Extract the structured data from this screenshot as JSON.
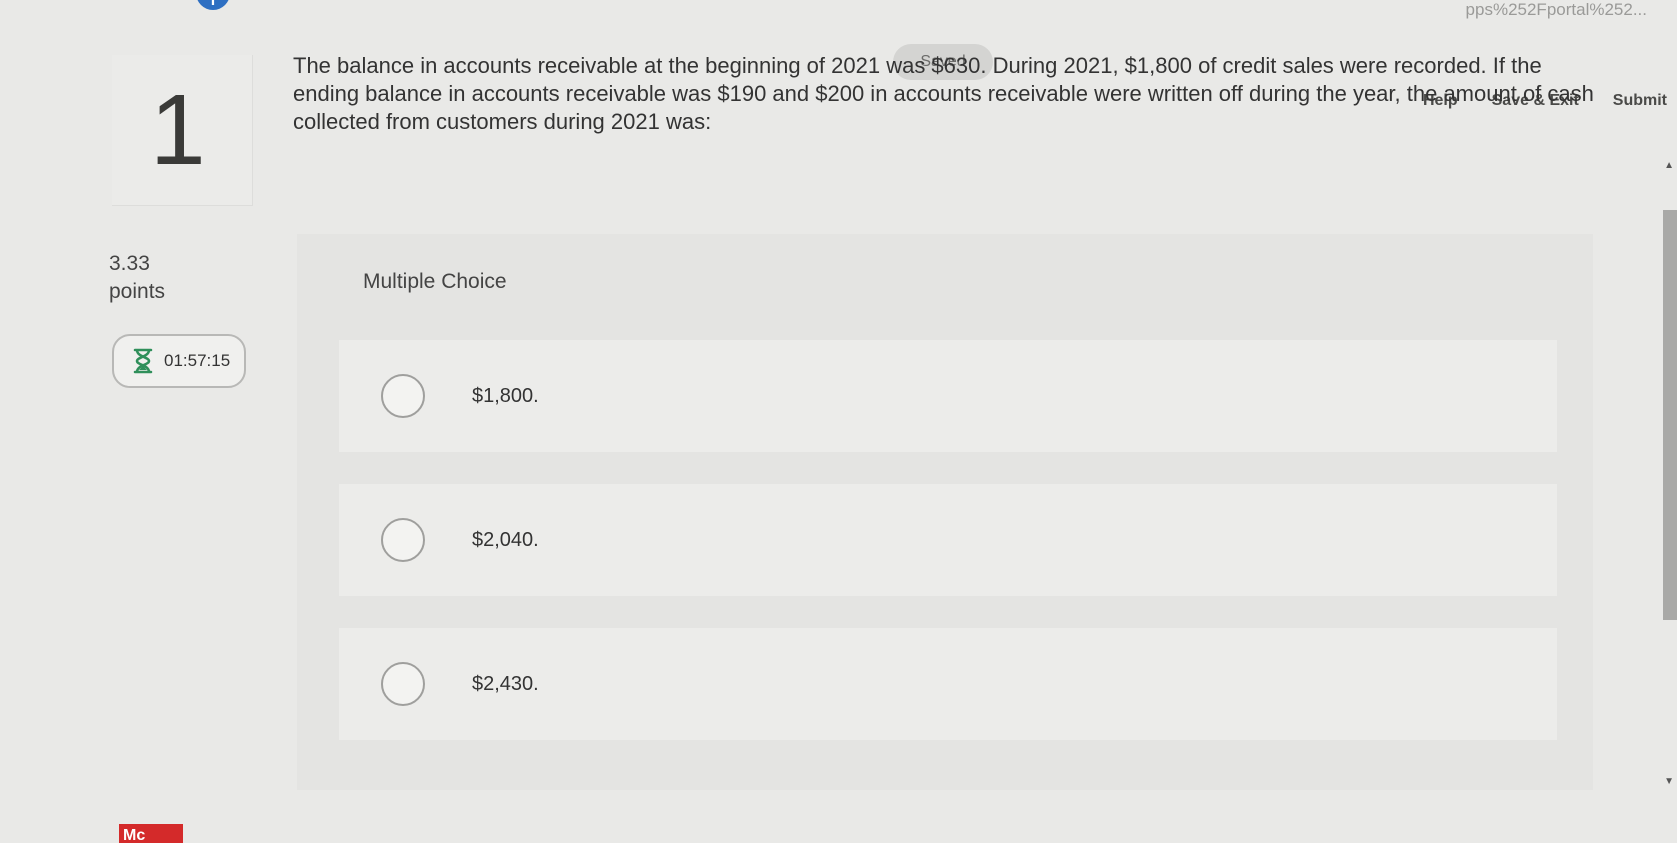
{
  "browser": {
    "url_fragment": "pps%252Fportal%252..."
  },
  "header": {
    "saved_status": "Saved",
    "links": {
      "help": "Help",
      "save_exit": "Save & Exit",
      "submit": "Submit"
    }
  },
  "question": {
    "number": "1",
    "text": "The balance in accounts receivable at the beginning of 2021 was $630. During 2021, $1,800 of credit sales were recorded. If the ending balance in accounts receivable was $190 and $200 in accounts receivable were written off during the year, the amount of cash collected from customers during 2021 was:",
    "points_value": "3.33",
    "points_label": "points"
  },
  "timer": {
    "icon": "hourglass-icon",
    "time": "01:57:15"
  },
  "multiple_choice": {
    "title": "Multiple Choice",
    "options": [
      {
        "label": "$1,800."
      },
      {
        "label": "$2,040."
      },
      {
        "label": "$2,430."
      }
    ]
  },
  "logo": {
    "text": "Mc"
  },
  "colors": {
    "accent_blue": "#2e6fc2",
    "logo_red": "#d42a2a"
  }
}
